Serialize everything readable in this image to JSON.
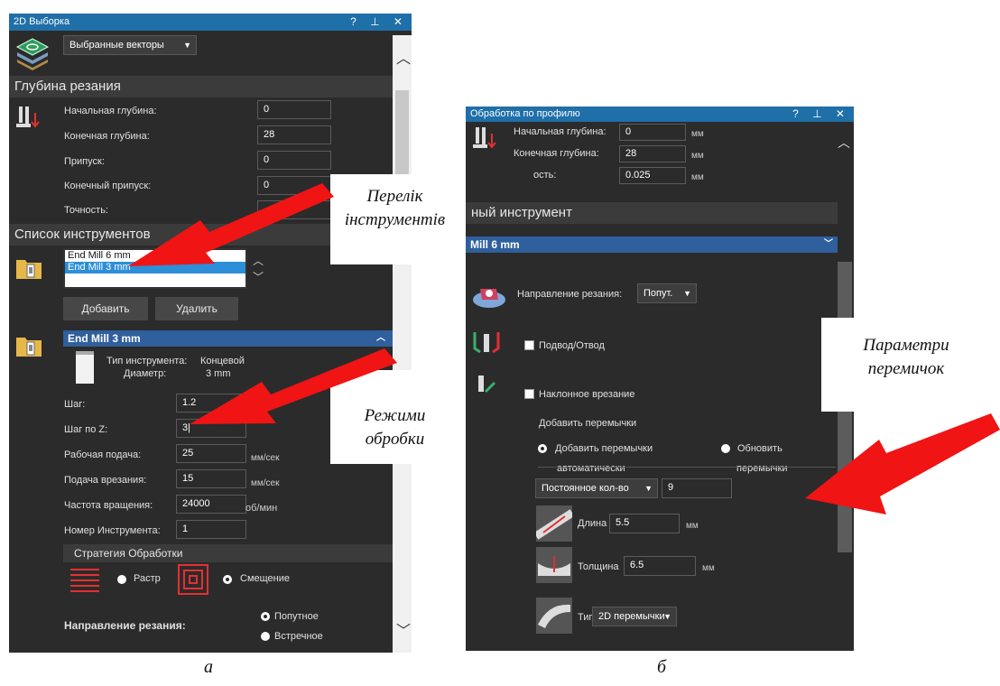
{
  "left": {
    "title": "2D Выборка",
    "title_icons": "? ⊥ ✕",
    "selection_combo": "Выбранные векторы",
    "depth_section": "Глубина резания",
    "fields": [
      {
        "label": "Начальная глубина:",
        "value": "0"
      },
      {
        "label": "Конечная глубина:",
        "value": "28"
      },
      {
        "label": "Припуск:",
        "value": "0"
      },
      {
        "label": "Конечный припуск:",
        "value": "0"
      },
      {
        "label": "Точность:",
        "value": ""
      }
    ],
    "tool_list_section": "Список инструментов",
    "tools": [
      "End Mill 6 mm",
      "End Mill 3 mm"
    ],
    "add_button": "Добавить",
    "delete_button": "Удалить",
    "tool_header": "End Mill 3 mm",
    "tool_type_label": "Тип инструмента:",
    "tool_type_value": "Концевой",
    "diameter_label": "Диаметр:",
    "diameter_value": "3 mm",
    "params": [
      {
        "label": "Шаг:",
        "value": "1.2",
        "unit": ""
      },
      {
        "label": "Шаг по Z:",
        "value": "3|",
        "unit": ""
      },
      {
        "label": "Рабочая подача:",
        "value": "25",
        "unit": "мм/сек"
      },
      {
        "label": "Подача врезания:",
        "value": "15",
        "unit": "мм/сек"
      },
      {
        "label": "Частота вращения:",
        "value": "24000",
        "unit": "об/мин"
      },
      {
        "label": "Номер Инструмента:",
        "value": "1",
        "unit": ""
      }
    ],
    "strategy_header": "Стратегия Обработки",
    "raster_label": "Растр",
    "offset_label": "Смещение",
    "cut_dir_label": "Направление резания:",
    "climb_label": "Попутное",
    "conventional_label": "Встречное"
  },
  "right": {
    "title": "Обработка по профилю",
    "title_icons": "? ⊥ ✕",
    "fields": [
      {
        "label": "Начальная глубина:",
        "value": "0",
        "unit": "мм"
      },
      {
        "label": "Конечная глубина:",
        "value": "28",
        "unit": "мм"
      },
      {
        "label": "ость:",
        "value": "0.025",
        "unit": "мм"
      }
    ],
    "tool_section": "ный инструмент",
    "tool_header": "Mill 6 mm",
    "cut_dir_label": "Направление резания:",
    "cut_dir_value": "Попут.",
    "lead_label": "Подвод/Отвод",
    "ramp_label": "Наклонное врезание",
    "add_tabs_label": "Добавить перемычки",
    "auto_tabs_label": "Добавить перемычки",
    "auto_tabs_label2": "автоматически",
    "update_tabs_label": "Обновить",
    "update_tabs_label2": "перемычки",
    "count_mode": "Постоянное кол-во",
    "count_value": "9",
    "length_label": "Длина",
    "length_value": "5.5",
    "thickness_label": "Толщина",
    "thickness_value": "6.5",
    "type_label": "Тип",
    "type_value": "2D перемычки",
    "unit": "мм"
  },
  "callouts": {
    "tools_list": [
      "Перелік",
      "інструментів"
    ],
    "modes": [
      "Режими",
      "обробки"
    ],
    "tab_params": [
      "Параметри",
      "перемичок"
    ]
  },
  "captions": {
    "a": "а",
    "b": "б"
  },
  "colors": {
    "arrow": "#f01414",
    "title": "#1f6fa8",
    "panel": "#2b2b2b",
    "header": "#2f5f9c"
  }
}
